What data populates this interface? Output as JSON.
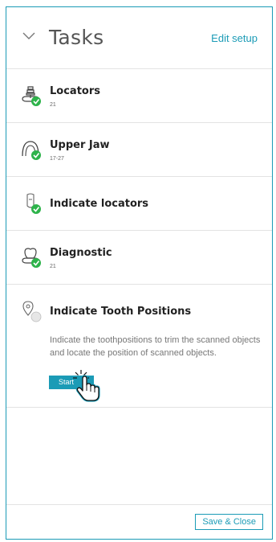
{
  "header": {
    "title": "Tasks",
    "edit_label": "Edit setup"
  },
  "tasks": [
    {
      "name": "Locators",
      "sub": "21",
      "status": "completed",
      "icon": "locator-tooth-icon"
    },
    {
      "name": "Upper Jaw",
      "sub": "17-27",
      "status": "completed",
      "icon": "upper-jaw-icon"
    },
    {
      "name": "Indicate locators",
      "sub": "",
      "status": "completed",
      "icon": "indicate-locator-icon"
    },
    {
      "name": "Diagnostic",
      "sub": "21",
      "status": "completed",
      "icon": "diagnostic-tooth-icon"
    },
    {
      "name": "Indicate Tooth Positions",
      "sub": "",
      "status": "pending",
      "icon": "tooth-position-pin-icon",
      "description": "Indicate the toothpositions to trim the scanned objects and locate the position of scanned objects.",
      "start_label": "Start"
    }
  ],
  "footer": {
    "save_close_label": "Save & Close"
  },
  "colors": {
    "accent": "#1b9bb6",
    "check": "#2db34a",
    "pending": "#d9d9d9"
  }
}
